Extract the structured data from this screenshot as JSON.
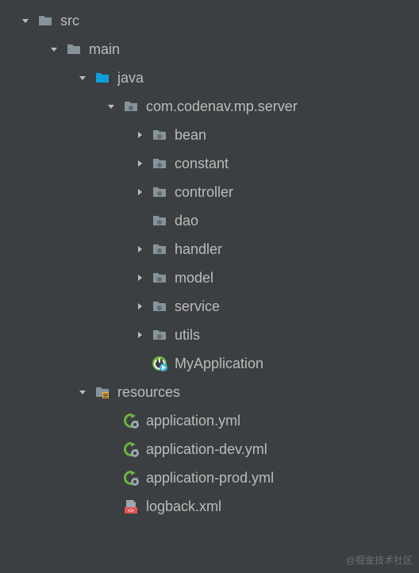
{
  "tree": [
    {
      "depth": 0,
      "arrow": "down",
      "icon": "folder-grey",
      "label": "src"
    },
    {
      "depth": 1,
      "arrow": "down",
      "icon": "folder-grey",
      "label": "main"
    },
    {
      "depth": 2,
      "arrow": "down",
      "icon": "folder-blue",
      "label": "java"
    },
    {
      "depth": 3,
      "arrow": "down",
      "icon": "package",
      "label": "com.codenav.mp.server"
    },
    {
      "depth": 4,
      "arrow": "right",
      "icon": "package",
      "label": "bean"
    },
    {
      "depth": 4,
      "arrow": "right",
      "icon": "package",
      "label": "constant"
    },
    {
      "depth": 4,
      "arrow": "right",
      "icon": "package",
      "label": "controller"
    },
    {
      "depth": 4,
      "arrow": "none",
      "icon": "package",
      "label": "dao"
    },
    {
      "depth": 4,
      "arrow": "right",
      "icon": "package",
      "label": "handler"
    },
    {
      "depth": 4,
      "arrow": "right",
      "icon": "package",
      "label": "model"
    },
    {
      "depth": 4,
      "arrow": "right",
      "icon": "package",
      "label": "service"
    },
    {
      "depth": 4,
      "arrow": "right",
      "icon": "package",
      "label": "utils"
    },
    {
      "depth": 4,
      "arrow": "none",
      "icon": "spring-boot",
      "label": "MyApplication"
    },
    {
      "depth": 2,
      "arrow": "down",
      "icon": "folder-resources",
      "label": "resources"
    },
    {
      "depth": 3,
      "arrow": "none",
      "icon": "spring-yml",
      "label": "application.yml"
    },
    {
      "depth": 3,
      "arrow": "none",
      "icon": "spring-yml",
      "label": "application-dev.yml"
    },
    {
      "depth": 3,
      "arrow": "none",
      "icon": "spring-yml",
      "label": "application-prod.yml"
    },
    {
      "depth": 3,
      "arrow": "none",
      "icon": "xml",
      "label": "logback.xml"
    }
  ],
  "watermark": "@掘金技术社区",
  "baseIndent": 20,
  "depthIndent": 36
}
